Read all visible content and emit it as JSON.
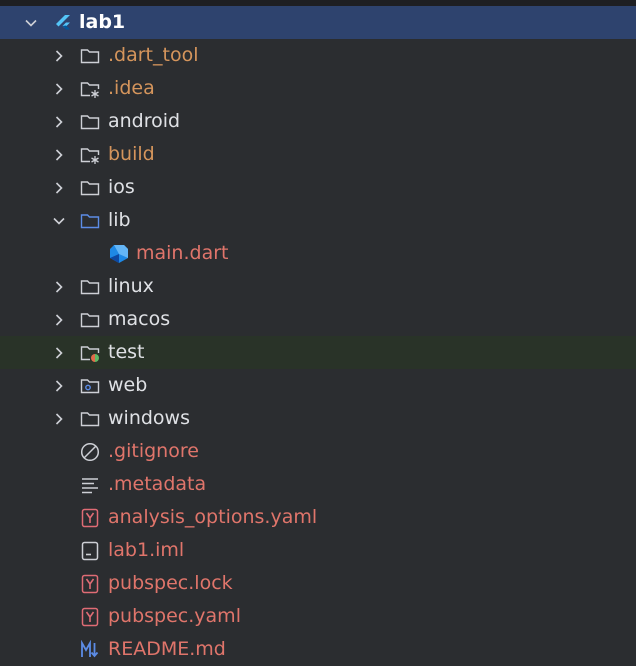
{
  "colors": {
    "background": "#2b2d30",
    "selected_row": "#2e436e",
    "test_row": "#293328",
    "text_default": "#dfe1e5",
    "text_excluded": "#d5955c",
    "text_modified": "#e0756b",
    "folder_stroke": "#ced0d6",
    "source_folder": "#5c8ce6"
  },
  "tree": {
    "root": {
      "label": "lab1",
      "icon": "flutter-icon",
      "expanded": true
    },
    "items": [
      {
        "label": ".dart_tool",
        "icon": "folder-icon",
        "expandable": true,
        "expanded": false
      },
      {
        "label": ".idea",
        "icon": "folder-config-icon",
        "expandable": true,
        "expanded": false
      },
      {
        "label": "android",
        "icon": "folder-icon",
        "expandable": true,
        "expanded": false
      },
      {
        "label": "build",
        "icon": "folder-config-icon",
        "expandable": true,
        "expanded": false
      },
      {
        "label": "ios",
        "icon": "folder-icon",
        "expandable": true,
        "expanded": false
      },
      {
        "label": "lib",
        "icon": "source-folder-icon",
        "expandable": true,
        "expanded": true
      },
      {
        "label": "main.dart",
        "icon": "dart-file-icon",
        "expandable": false
      },
      {
        "label": "linux",
        "icon": "folder-icon",
        "expandable": true,
        "expanded": false
      },
      {
        "label": "macos",
        "icon": "folder-icon",
        "expandable": true,
        "expanded": false
      },
      {
        "label": "test",
        "icon": "test-folder-icon",
        "expandable": true,
        "expanded": false
      },
      {
        "label": "web",
        "icon": "web-folder-icon",
        "expandable": true,
        "expanded": false
      },
      {
        "label": "windows",
        "icon": "folder-icon",
        "expandable": true,
        "expanded": false
      },
      {
        "label": ".gitignore",
        "icon": "ignore-file-icon",
        "expandable": false
      },
      {
        "label": ".metadata",
        "icon": "text-file-icon",
        "expandable": false
      },
      {
        "label": "analysis_options.yaml",
        "icon": "yaml-file-icon",
        "expandable": false
      },
      {
        "label": "lab1.iml",
        "icon": "iml-file-icon",
        "expandable": false
      },
      {
        "label": "pubspec.lock",
        "icon": "yaml-file-icon",
        "expandable": false
      },
      {
        "label": "pubspec.yaml",
        "icon": "yaml-file-icon",
        "expandable": false
      },
      {
        "label": "README.md",
        "icon": "markdown-file-icon",
        "expandable": false
      }
    ]
  }
}
